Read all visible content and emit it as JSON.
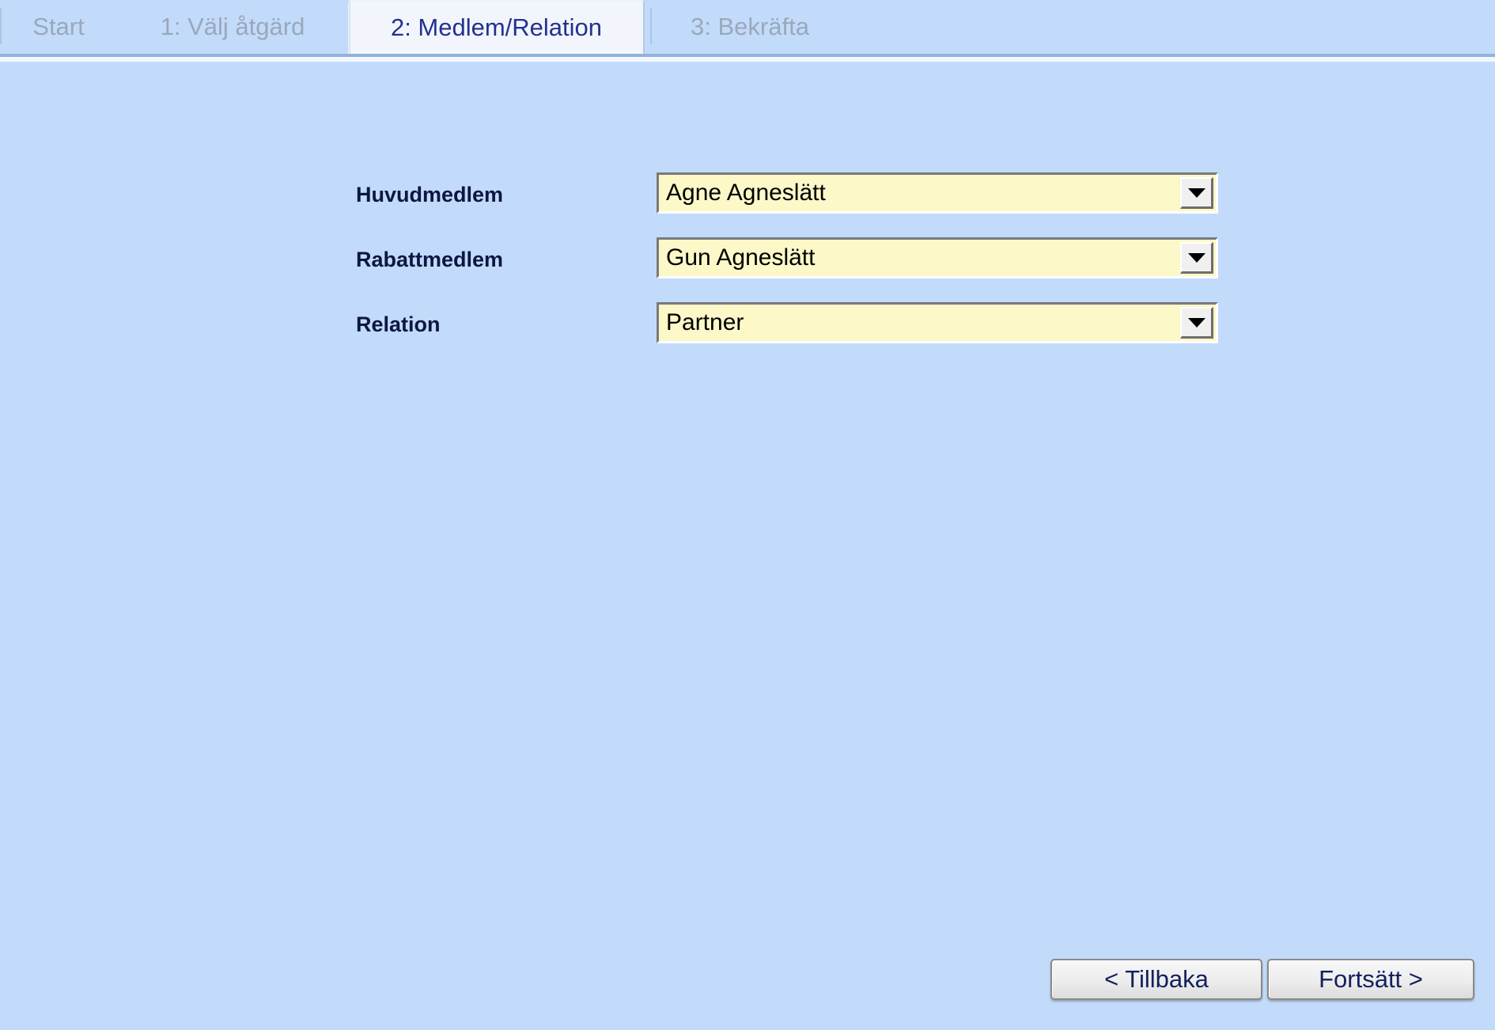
{
  "theme": {
    "page_background": "#c2dbfa",
    "active_tab_background": "#f2f6fc",
    "active_tab_text": "#24318f",
    "inactive_tab_text": "#9aa8bb",
    "field_background": "#fcf8c8",
    "label_text": "#0d1642",
    "button_text": "#14205e"
  },
  "tabs": [
    {
      "label": "Start",
      "active": false
    },
    {
      "label": "1: Välj åtgärd",
      "active": false
    },
    {
      "label": "2: Medlem/Relation",
      "active": true
    },
    {
      "label": "3: Bekräfta",
      "active": false
    }
  ],
  "form": {
    "fields": [
      {
        "label": "Huvudmedlem",
        "value": "Agne Agneslätt",
        "icon": "chevron-down-icon"
      },
      {
        "label": "Rabattmedlem",
        "value": "Gun Agneslätt",
        "icon": "chevron-down-icon"
      },
      {
        "label": "Relation",
        "value": "Partner",
        "icon": "chevron-down-icon"
      }
    ]
  },
  "footer": {
    "back_label": "< Tillbaka",
    "next_label": "Fortsätt >"
  }
}
